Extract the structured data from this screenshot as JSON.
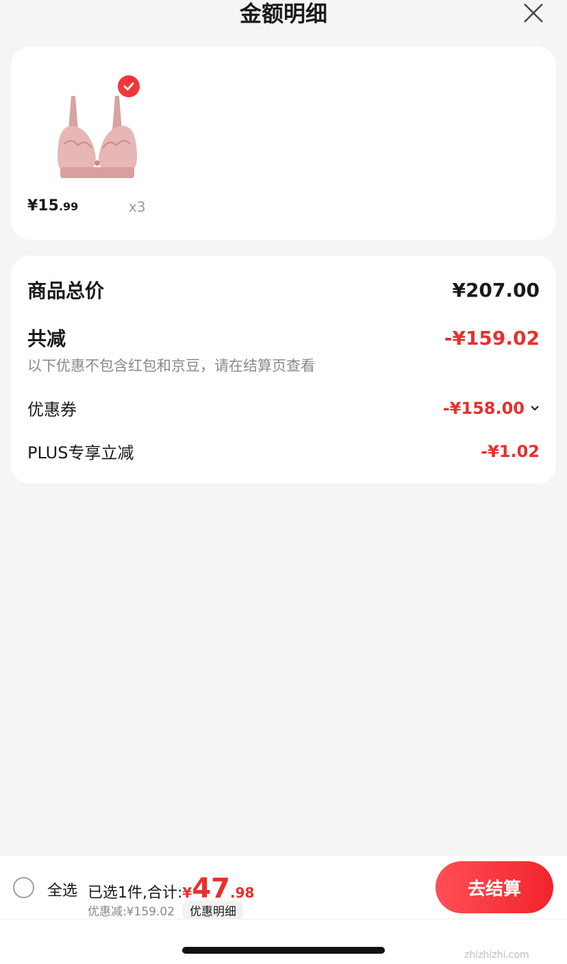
{
  "header": {
    "title": "金额明细"
  },
  "product": {
    "price_int": "¥15",
    "price_dec": ".99",
    "quantity": "x3"
  },
  "summary": {
    "goods_total_label": "商品总价",
    "goods_total_value": "¥207.00",
    "reduce_label": "共减",
    "reduce_value": "-¥159.02",
    "note": "以下优惠不包含红包和京豆，请在结算页查看",
    "coupon_label": "优惠券",
    "coupon_value": "-¥158.00",
    "plus_label": "PLUS专享立减",
    "plus_value": "-¥1.02"
  },
  "bottom": {
    "select_all": "全选",
    "selected_text": "已选1件,合计:",
    "total_symbol": "¥",
    "total_int": "47",
    "total_dec": ".98",
    "discount_text": "优惠减:¥159.02",
    "detail_chip": "优惠明细",
    "checkout": "去结算"
  },
  "watermark": "zhizhizhi.com",
  "colors": {
    "accent": "#e8302b",
    "check_badge": "#f2353a"
  }
}
